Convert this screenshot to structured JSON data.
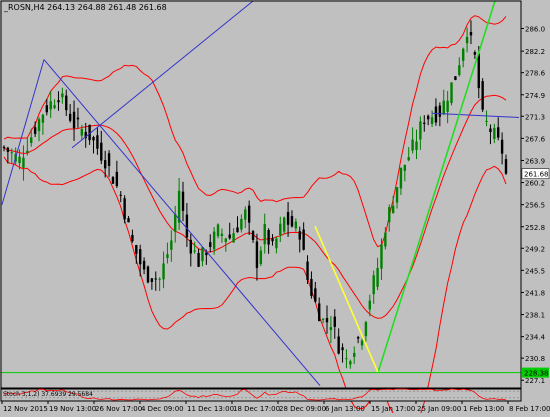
{
  "chart_data": {
    "type": "candlestick",
    "symbol_line": "_ROSN,H4  264.13 264.88 261.48 261.68",
    "price_axis": {
      "ylim": [
        225.8,
        290.6
      ],
      "ticks": [
        "286.0",
        "282.2",
        "278.6",
        "274.9",
        "271.3",
        "267.6",
        "263.9",
        "260.2",
        "256.5",
        "252.8",
        "249.2",
        "245.5",
        "241.8",
        "238.1",
        "234.4",
        "230.8",
        "227.1"
      ],
      "current_price_label": "261.68",
      "support_label": "228.38",
      "support_price": 228.38
    },
    "time_axis": {
      "tick_labels": [
        "12 Nov 2015",
        "19 Nov 13:00",
        "26 Nov 17:00",
        "4 Dec 09:00",
        "11 Dec 13:00",
        "18 Dec 17:00",
        "28 Dec 09:00",
        "6 Jan 13:00",
        "15 Jan 17:00",
        "25 Jan 09:00",
        "1 Feb 13:00",
        "8 Feb 17:00"
      ]
    },
    "price_keypoints": [
      [
        0,
        266.0
      ],
      [
        4,
        264.0
      ],
      [
        10,
        272.0
      ],
      [
        14,
        275.0
      ],
      [
        18,
        270.0
      ],
      [
        22,
        268.0
      ],
      [
        26,
        264.0
      ],
      [
        30,
        258.0
      ],
      [
        33,
        250.0
      ],
      [
        36,
        245.0
      ],
      [
        40,
        244.0
      ],
      [
        43,
        250.5
      ],
      [
        45,
        259.0
      ],
      [
        47,
        251.0
      ],
      [
        50,
        247.0
      ],
      [
        53,
        250.0
      ],
      [
        55,
        252.0
      ],
      [
        58,
        251.0
      ],
      [
        62,
        255.0
      ],
      [
        65,
        247.0
      ],
      [
        67,
        252.0
      ],
      [
        69,
        249.0
      ],
      [
        72,
        254.0
      ],
      [
        76,
        252.0
      ],
      [
        78,
        244.0
      ],
      [
        80,
        240.0
      ],
      [
        82,
        237.0
      ],
      [
        84,
        237.0
      ],
      [
        86,
        233.0
      ],
      [
        88,
        230.5
      ],
      [
        90,
        233.0
      ],
      [
        92,
        235.0
      ],
      [
        94,
        241.0
      ],
      [
        96,
        246.0
      ],
      [
        98,
        253.0
      ],
      [
        102,
        262.0
      ],
      [
        105,
        266.0
      ],
      [
        108,
        271.0
      ],
      [
        112,
        272.0
      ],
      [
        116,
        278.0
      ],
      [
        119,
        286.0
      ],
      [
        121,
        281.0
      ],
      [
        123,
        271.0
      ],
      [
        126,
        268.0
      ],
      [
        128,
        265.5
      ],
      [
        129,
        263.0
      ]
    ],
    "bollinger_bands": "red upper/middle/lower bands around price",
    "indicator": {
      "label": "Stoch 3,1,2) 37.6939 29.5684",
      "levels": [
        80,
        20
      ]
    },
    "colors": {
      "background": "#c0c0c0",
      "bull_candle": "#008000",
      "bear_candle": "#000000",
      "bands": "#ff0000",
      "trendline_blue": "#3333cc",
      "trendline_green": "#22dd22",
      "trendline_yellow": "#ffff33",
      "support_line": "#00cc00",
      "ticker_box_bg": "#ffffff",
      "axis_text": "#000000"
    }
  }
}
